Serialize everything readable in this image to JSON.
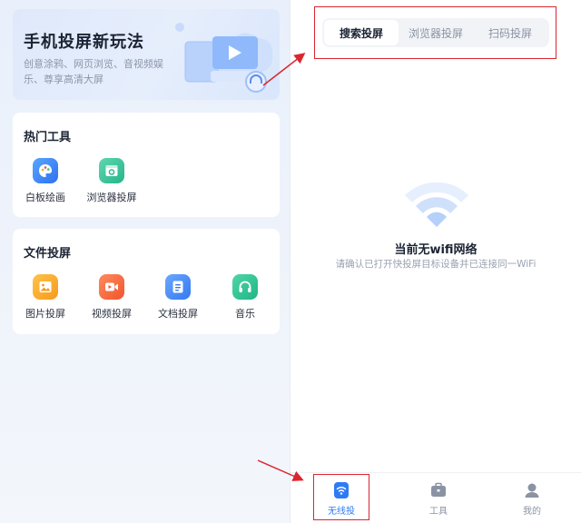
{
  "banner": {
    "title": "手机投屏新玩法",
    "subtitle": "创意涂鸦、网页浏览、音视频娱乐、尊享高清大屏"
  },
  "hot_tools": {
    "title": "热门工具",
    "items": [
      {
        "label": "白板绘画",
        "icon": "palette-icon"
      },
      {
        "label": "浏览器投屏",
        "icon": "browser-icon"
      }
    ]
  },
  "file_cast": {
    "title": "文件投屏",
    "items": [
      {
        "label": "图片投屏",
        "icon": "image-icon"
      },
      {
        "label": "视频投屏",
        "icon": "video-icon"
      },
      {
        "label": "文档投屏",
        "icon": "document-icon"
      },
      {
        "label": "音乐",
        "icon": "headphones-icon"
      }
    ]
  },
  "tabs": [
    {
      "label": "搜索投屏",
      "active": true
    },
    {
      "label": "浏览器投屏",
      "active": false
    },
    {
      "label": "扫码投屏",
      "active": false
    }
  ],
  "empty_state": {
    "title": "当前无wifi网络",
    "subtitle": "请确认已打开快投屏目标设备并已连接同一WiFi"
  },
  "bottom_nav": [
    {
      "label": "无线投",
      "icon": "wifi-icon",
      "active": true
    },
    {
      "label": "工具",
      "icon": "toolbox-icon",
      "active": false
    },
    {
      "label": "我的",
      "icon": "profile-icon",
      "active": false
    }
  ],
  "colors": {
    "accent": "#2f7bf5",
    "annotation_red": "#d9262f"
  }
}
